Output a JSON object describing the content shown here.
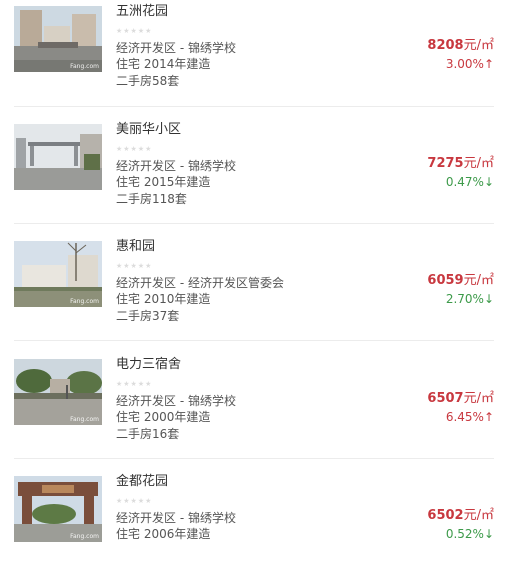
{
  "listings": [
    {
      "name": "五洲花园",
      "location": "经济开发区 - 锦绣学校",
      "built": "住宅 2014年建造",
      "second_hand": "二手房58套",
      "price_value": "8208",
      "price_unit": "元/㎡",
      "change": "3.00%",
      "direction": "up",
      "arrow": "↑",
      "stars": "★★★★★",
      "watermark": "Fang.com"
    },
    {
      "name": "美丽华小区",
      "location": "经济开发区 - 锦绣学校",
      "built": "住宅 2015年建造",
      "second_hand": "二手房118套",
      "price_value": "7275",
      "price_unit": "元/㎡",
      "change": "0.47%",
      "direction": "down",
      "arrow": "↓",
      "stars": "★★★★★",
      "watermark": ""
    },
    {
      "name": "惠和园",
      "location": "经济开发区 - 经济开发区管委会",
      "built": "住宅 2010年建造",
      "second_hand": "二手房37套",
      "price_value": "6059",
      "price_unit": "元/㎡",
      "change": "2.70%",
      "direction": "down",
      "arrow": "↓",
      "stars": "★★★★★",
      "watermark": "Fang.com"
    },
    {
      "name": "电力三宿舍",
      "location": "经济开发区 - 锦绣学校",
      "built": "住宅 2000年建造",
      "second_hand": "二手房16套",
      "price_value": "6507",
      "price_unit": "元/㎡",
      "change": "6.45%",
      "direction": "up",
      "arrow": "↑",
      "stars": "★★★★★",
      "watermark": "Fang.com"
    },
    {
      "name": "金都花园",
      "location": "经济开发区 - 锦绣学校",
      "built": "住宅 2006年建造",
      "second_hand": "",
      "price_value": "6502",
      "price_unit": "元/㎡",
      "change": "0.52%",
      "direction": "down",
      "arrow": "↓",
      "stars": "★★★★★",
      "watermark": "Fang.com"
    }
  ]
}
